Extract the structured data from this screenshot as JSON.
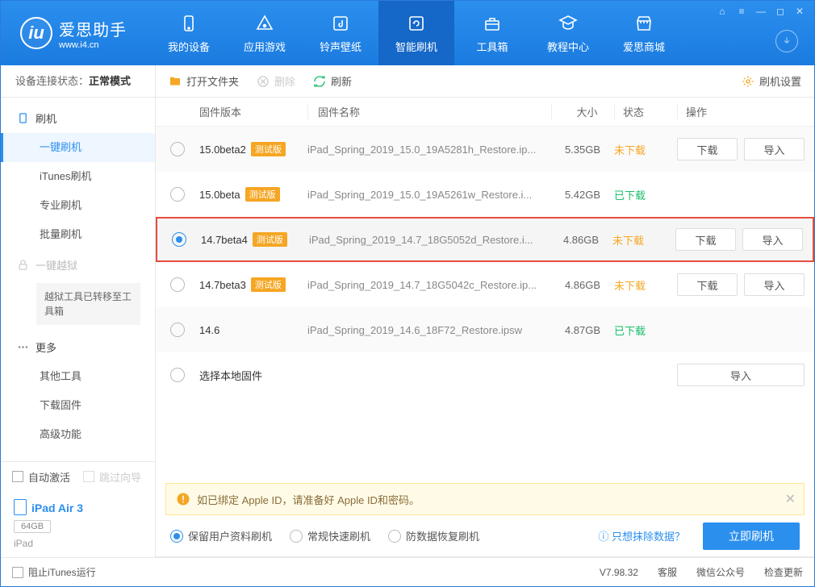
{
  "app": {
    "title": "爱思助手",
    "url": "www.i4.cn"
  },
  "win_buttons": [
    "⌂",
    "≡",
    "—",
    "◻",
    "✕"
  ],
  "nav": [
    {
      "label": "我的设备",
      "icon": "phone"
    },
    {
      "label": "应用游戏",
      "icon": "apps"
    },
    {
      "label": "铃声壁纸",
      "icon": "music"
    },
    {
      "label": "智能刷机",
      "icon": "refresh",
      "active": true
    },
    {
      "label": "工具箱",
      "icon": "toolbox"
    },
    {
      "label": "教程中心",
      "icon": "academy"
    },
    {
      "label": "爱思商城",
      "icon": "store"
    }
  ],
  "status": {
    "label": "设备连接状态：",
    "value": "正常模式"
  },
  "sidebar": {
    "flash": {
      "title": "刷机",
      "items": [
        "一键刷机",
        "iTunes刷机",
        "专业刷机",
        "批量刷机"
      ],
      "active": 0
    },
    "jailbreak": {
      "title": "一键越狱",
      "note": "越狱工具已转移至工具箱"
    },
    "more": {
      "title": "更多",
      "items": [
        "其他工具",
        "下载固件",
        "高级功能"
      ]
    }
  },
  "side_bottom": {
    "auto_activate": "自动激活",
    "skip_guide": "跳过向导"
  },
  "device": {
    "name": "iPad Air 3",
    "storage": "64GB",
    "type": "iPad"
  },
  "toolbar": {
    "open": "打开文件夹",
    "delete": "删除",
    "refresh": "刷新",
    "settings": "刷机设置"
  },
  "columns": {
    "version": "固件版本",
    "name": "固件名称",
    "size": "大小",
    "status": "状态",
    "ops": "操作"
  },
  "status_txt": {
    "nd": "未下载",
    "dn": "已下载"
  },
  "btn_txt": {
    "download": "下载",
    "import": "导入"
  },
  "rows": [
    {
      "sel": false,
      "ver": "15.0beta2",
      "beta": true,
      "name": "iPad_Spring_2019_15.0_19A5281h_Restore.ip...",
      "size": "5.35GB",
      "status": "nd",
      "ops": [
        "download",
        "import"
      ]
    },
    {
      "sel": false,
      "ver": "15.0beta",
      "beta": true,
      "name": "iPad_Spring_2019_15.0_19A5261w_Restore.i...",
      "size": "5.42GB",
      "status": "dn"
    },
    {
      "sel": true,
      "hl": true,
      "ver": "14.7beta4",
      "beta": true,
      "name": "iPad_Spring_2019_14.7_18G5052d_Restore.i...",
      "size": "4.86GB",
      "status": "nd",
      "ops": [
        "download",
        "import"
      ]
    },
    {
      "sel": false,
      "ver": "14.7beta3",
      "beta": true,
      "name": "iPad_Spring_2019_14.7_18G5042c_Restore.ip...",
      "size": "4.86GB",
      "status": "nd",
      "ops": [
        "download",
        "import"
      ]
    },
    {
      "sel": false,
      "ver": "14.6",
      "beta": false,
      "name": "iPad_Spring_2019_14.6_18F72_Restore.ipsw",
      "size": "4.87GB",
      "status": "dn"
    },
    {
      "sel": false,
      "ver": "选择本地固件",
      "beta": false,
      "name": "",
      "size": "",
      "ops": [
        "import"
      ]
    }
  ],
  "beta_label": "测试版",
  "notice": "如已绑定 Apple ID，请准备好 Apple ID和密码。",
  "flash_opts": {
    "opts": [
      "保留用户资料刷机",
      "常规快速刷机",
      "防数据恢复刷机"
    ],
    "sel": 0,
    "link": "只想抹除数据？",
    "go": "立即刷机"
  },
  "footer": {
    "block": "阻止iTunes运行",
    "ver": "V7.98.32",
    "links": [
      "客服",
      "微信公众号",
      "检查更新"
    ]
  }
}
